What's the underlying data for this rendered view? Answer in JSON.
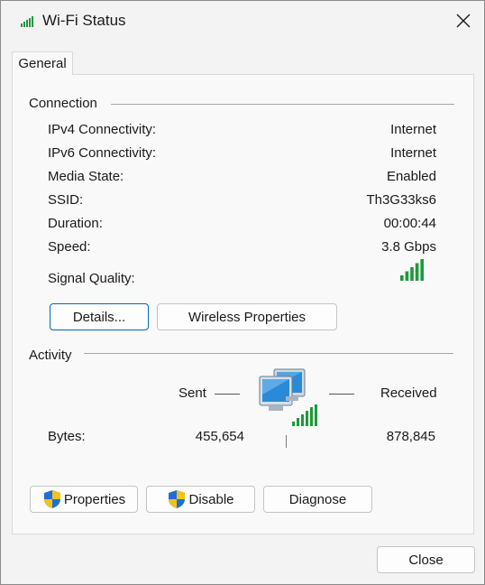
{
  "window": {
    "title": "Wi-Fi Status"
  },
  "tabs": [
    {
      "label": "General"
    }
  ],
  "connection": {
    "section_label": "Connection",
    "rows": [
      {
        "label": "IPv4 Connectivity:",
        "value": "Internet"
      },
      {
        "label": "IPv6 Connectivity:",
        "value": "Internet"
      },
      {
        "label": "Media State:",
        "value": "Enabled"
      },
      {
        "label": "SSID:",
        "value": "Th3G33ks6"
      },
      {
        "label": "Duration:",
        "value": "00:00:44"
      },
      {
        "label": "Speed:",
        "value": "3.8 Gbps"
      }
    ],
    "signal_label": "Signal Quality:",
    "signal_bars_filled": 5,
    "signal_bars_total": 5,
    "details_button": "Details...",
    "wireless_button": "Wireless Properties"
  },
  "activity": {
    "section_label": "Activity",
    "sent_label": "Sent",
    "received_label": "Received",
    "bytes_label": "Bytes:",
    "bytes_sent": "455,654",
    "bytes_received": "878,845"
  },
  "actions": {
    "properties": "Properties",
    "disable": "Disable",
    "diagnose": "Diagnose"
  },
  "footer": {
    "close": "Close"
  },
  "colors": {
    "signal_green": "#1e9a3a",
    "focus_blue": "#0067c0",
    "monitor_blue": "#2a8ad8"
  }
}
